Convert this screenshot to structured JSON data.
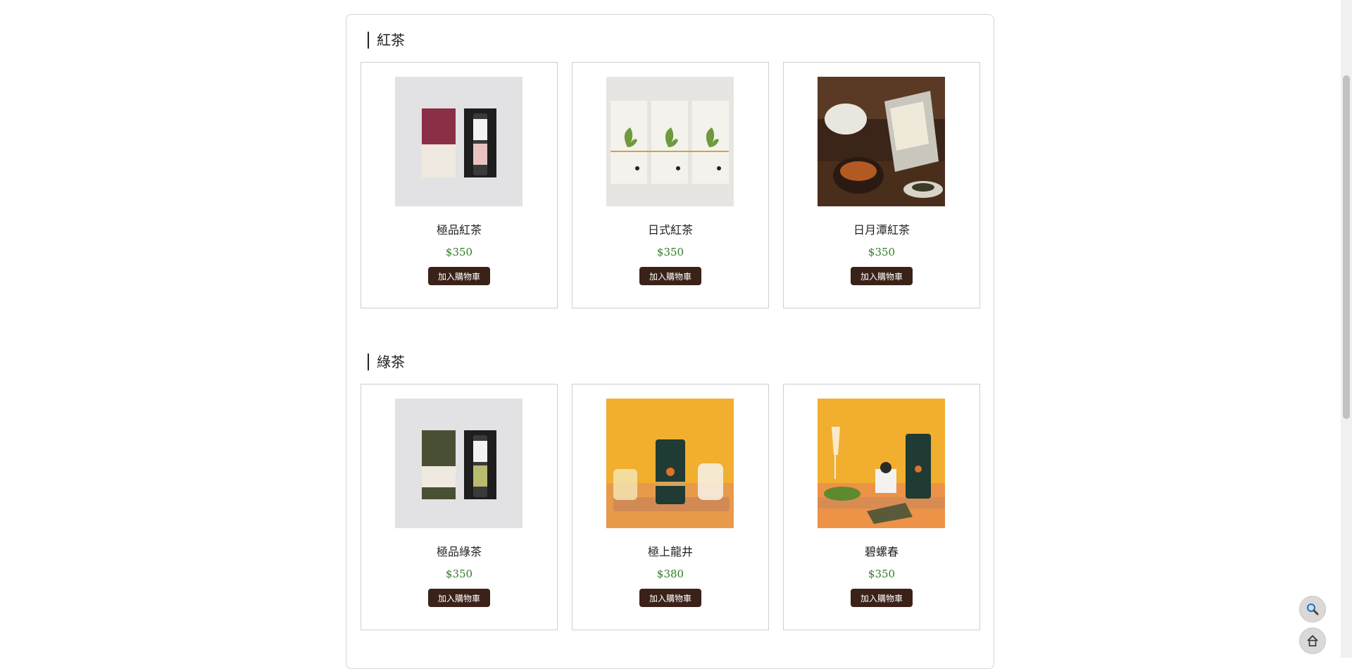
{
  "sections": [
    {
      "title": "紅茶",
      "products": [
        {
          "name": "極品紅茶",
          "price": "$350",
          "button": "加入購物車",
          "image": "box-and-tin-maroon"
        },
        {
          "name": "日式紅茶",
          "price": "$350",
          "button": "加入購物車",
          "image": "three-white-tea-boxes"
        },
        {
          "name": "日月潭紅茶",
          "price": "$350",
          "button": "加入購物車",
          "image": "tea-set-with-foil-pouch"
        }
      ]
    },
    {
      "title": "綠茶",
      "products": [
        {
          "name": "極品綠茶",
          "price": "$350",
          "button": "加入購物車",
          "image": "box-and-tin-olive"
        },
        {
          "name": "極上龍井",
          "price": "$380",
          "button": "加入購物車",
          "image": "green-canister-orange-backdrop"
        },
        {
          "name": "碧螺春",
          "price": "$350",
          "button": "加入購物車",
          "image": "canister-with-champagne-glass"
        }
      ]
    }
  ],
  "floating_buttons": [
    {
      "icon": "search-icon"
    },
    {
      "icon": "home-icon"
    }
  ],
  "colors": {
    "price": "#2e7d23",
    "button_bg": "#3a2218",
    "border": "#cfcfcf"
  }
}
